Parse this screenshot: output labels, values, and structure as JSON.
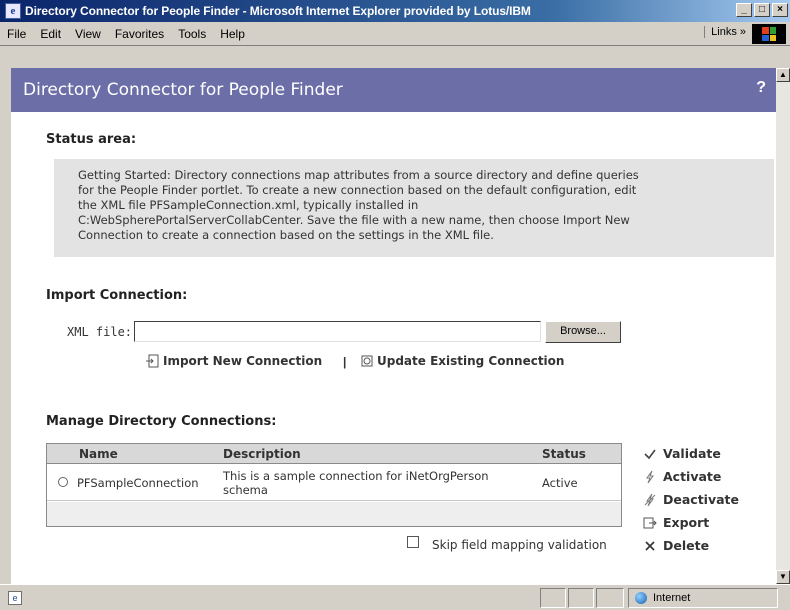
{
  "window": {
    "title": "Directory Connector for People Finder - Microsoft Internet Explorer provided by Lotus/IBM",
    "app_icon": "e",
    "buttons": {
      "minimize": "_",
      "maximize": "□",
      "close": "×"
    }
  },
  "menu": {
    "items": [
      "File",
      "Edit",
      "View",
      "Favorites",
      "Tools",
      "Help"
    ],
    "links": "Links »"
  },
  "portlet": {
    "title": "Directory Connector for People Finder",
    "help": "?"
  },
  "status_area": {
    "heading": "Status area:",
    "lines": [
      "Getting Started: Directory connections map attributes from a source directory and define queries",
      "for the People Finder portlet. To create a new connection based on the default configuration, edit",
      "the XML file PFSampleConnection.xml, typically installed in",
      "C:WebSpherePortalServerCollabCenter. Save the file with a new name, then choose Import New",
      "Connection to create a connection based on the settings in the XML file."
    ]
  },
  "import": {
    "heading": "Import Connection:",
    "xml_label": "XML file:",
    "xml_value": "",
    "browse": "Browse...",
    "import_new": "Import New Connection",
    "separator": "|",
    "update_existing": "Update Existing Connection"
  },
  "manage": {
    "heading": "Manage Directory Connections:",
    "columns": [
      "Name",
      "Description",
      "Status"
    ],
    "rows": [
      {
        "name": "PFSampleConnection",
        "description_line1": "This is a sample connection for iNetOrgPerson",
        "description_line2": "schema",
        "status": "Active"
      }
    ],
    "actions": {
      "validate": "Validate",
      "activate": "Activate",
      "deactivate": "Deactivate",
      "export": "Export",
      "delete": "Delete"
    },
    "skip_label": "Skip field mapping validation"
  },
  "statusbar": {
    "zone": "Internet"
  },
  "colors": {
    "header_band": "#6c6ea8",
    "status_box": "#e3e3e3",
    "title_bar": "#0a246a"
  }
}
